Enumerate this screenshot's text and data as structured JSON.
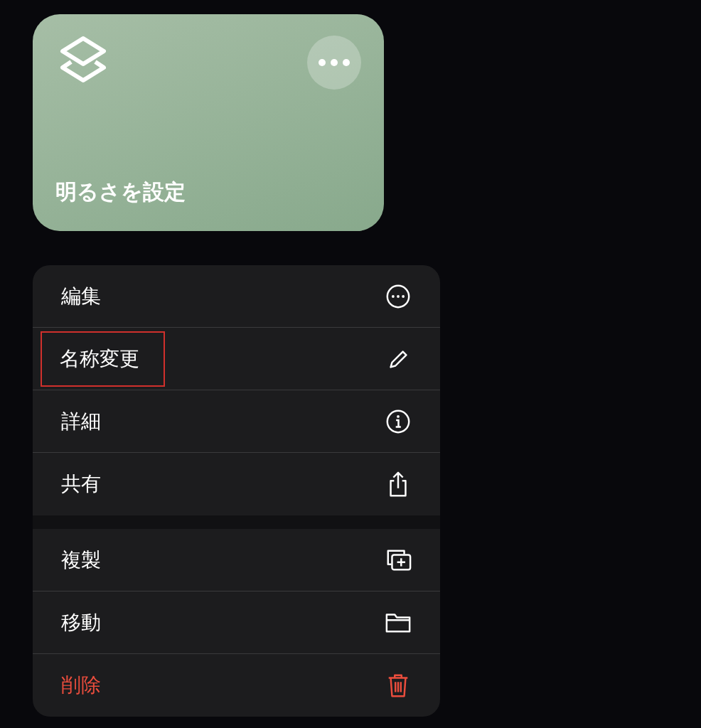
{
  "shortcut_card": {
    "title": "明るさを設定"
  },
  "menu": {
    "sections": [
      {
        "items": [
          {
            "label": "編集",
            "kind": "edit",
            "destructive": false,
            "highlighted": false
          },
          {
            "label": "名称変更",
            "kind": "rename",
            "destructive": false,
            "highlighted": true
          },
          {
            "label": "詳細",
            "kind": "details",
            "destructive": false,
            "highlighted": false
          },
          {
            "label": "共有",
            "kind": "share",
            "destructive": false,
            "highlighted": false
          }
        ]
      },
      {
        "items": [
          {
            "label": "複製",
            "kind": "duplicate",
            "destructive": false,
            "highlighted": false
          },
          {
            "label": "移動",
            "kind": "move",
            "destructive": false,
            "highlighted": false
          },
          {
            "label": "削除",
            "kind": "delete",
            "destructive": true,
            "highlighted": false
          }
        ]
      }
    ]
  }
}
